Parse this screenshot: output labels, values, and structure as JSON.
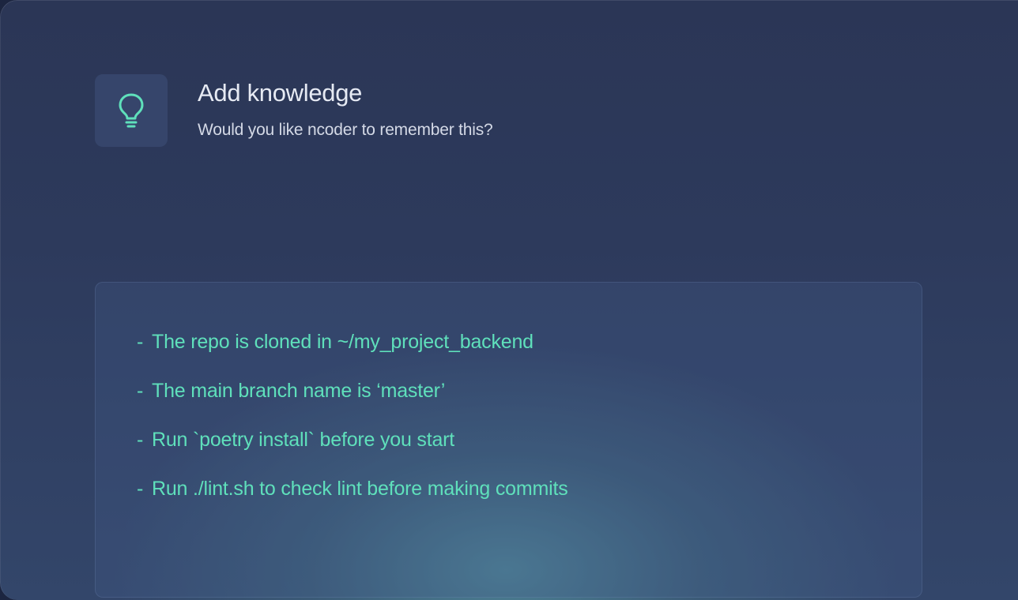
{
  "dialog": {
    "title": "Add knowledge",
    "subtitle": "Would you like ncoder to remember this?",
    "icon": "lightbulb-icon",
    "accent_color": "#5fe0bb"
  },
  "knowledge": {
    "bullet": "-",
    "items": [
      "The repo is cloned in ~/my_project_backend",
      "The main branch name is ‘master’",
      "Run `poetry install` before you start",
      "Run ./lint.sh to check lint before making commits"
    ]
  }
}
